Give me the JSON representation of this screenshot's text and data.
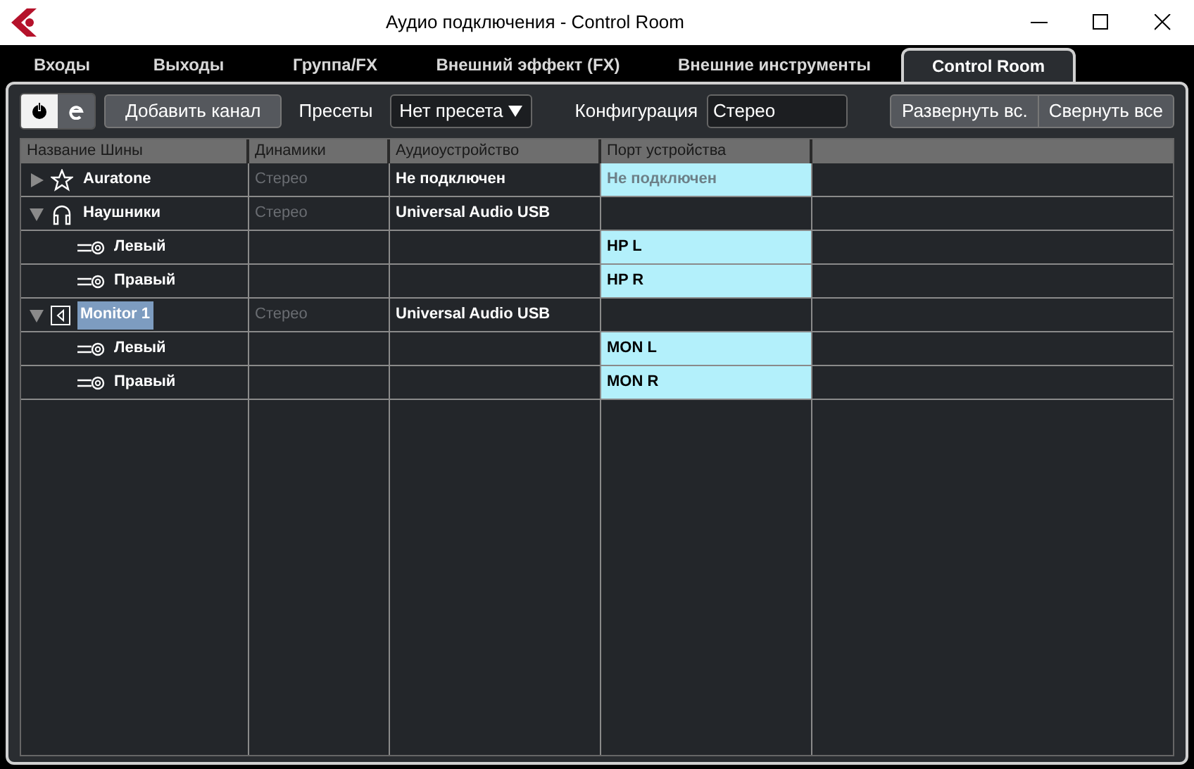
{
  "window": {
    "title": "Аудио подключения - Control Room"
  },
  "tabs": [
    {
      "label": "Входы",
      "selected": false
    },
    {
      "label": "Выходы",
      "selected": false
    },
    {
      "label": "Группа/FX",
      "selected": false
    },
    {
      "label": "Внешний эффект (FX)",
      "selected": false
    },
    {
      "label": "Внешние инструменты",
      "selected": false
    },
    {
      "label": "Control Room",
      "selected": true
    }
  ],
  "toolbar": {
    "toggles": [
      {
        "kind": "power",
        "selected": true
      },
      {
        "kind": "edit",
        "selected": false
      }
    ],
    "add_button": "Добавить канал",
    "presets_label": "Пресеты",
    "preset_value": "Нет пресета",
    "config_label": "Конфигурация",
    "config_value": "Стерео",
    "buttons": [
      "Развернуть вс.",
      "Свернуть все"
    ]
  },
  "table": {
    "columns": [
      "Название Шины",
      "Динамики",
      "Аудиоустройство",
      "Порт устройства"
    ],
    "rows": [
      {
        "kind": "star",
        "name": "Auratone",
        "expanded": false,
        "selected": false,
        "speakers": "Стерео",
        "device": "Не подключен",
        "port": {
          "text": "Не подключен",
          "connected": false
        }
      },
      {
        "kind": "headphones",
        "name": "Наушники",
        "expanded": true,
        "selected": false,
        "speakers": "Стерео",
        "device": "Universal Audio USB",
        "children": [
          {
            "kind": "channel",
            "name": "Левый",
            "selected": false,
            "port": {
              "text": "HP L",
              "connected": true
            }
          },
          {
            "kind": "channel",
            "name": "Правый",
            "selected": false,
            "port": {
              "text": "HP R",
              "connected": true
            }
          }
        ]
      },
      {
        "kind": "monitor",
        "name": "Monitor 1",
        "expanded": true,
        "selected": true,
        "speakers": "Стерео",
        "device": "Universal Audio USB",
        "children": [
          {
            "kind": "channel",
            "name": "Левый",
            "selected": false,
            "port": {
              "text": "MON L",
              "connected": true
            }
          },
          {
            "kind": "channel",
            "name": "Правый",
            "selected": false,
            "port": {
              "text": "MON R",
              "connected": true
            }
          }
        ]
      }
    ]
  }
}
